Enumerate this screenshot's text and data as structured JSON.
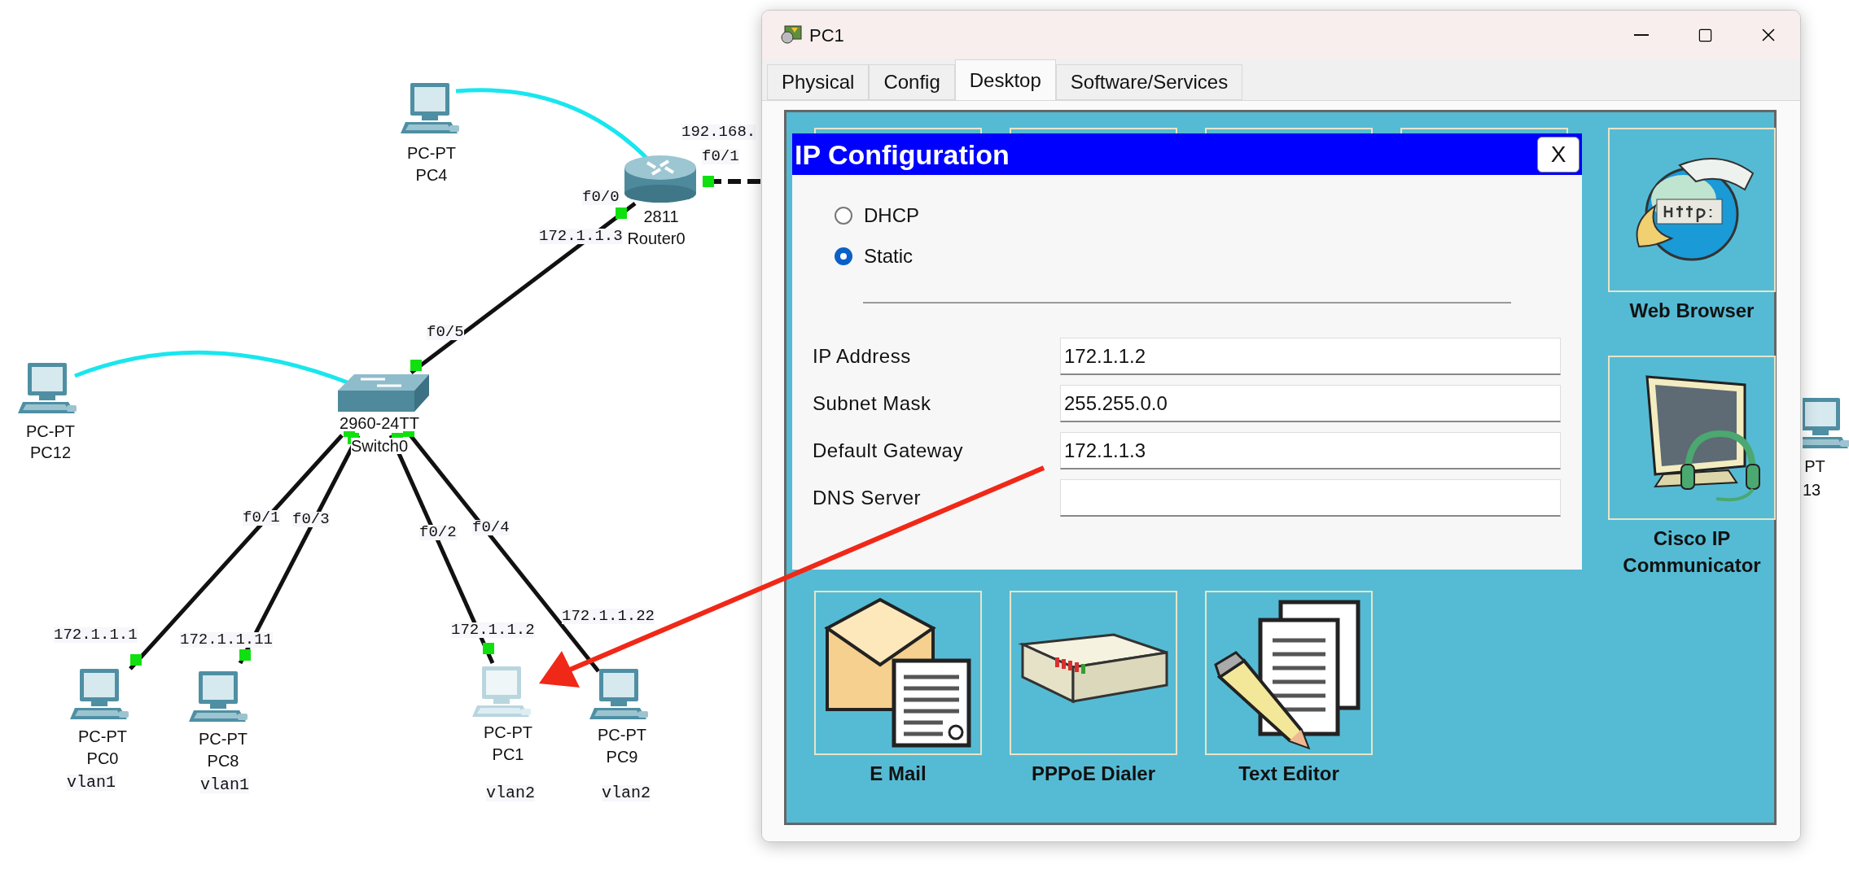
{
  "topology": {
    "devices": [
      {
        "kind": "pc",
        "model": "PC-PT",
        "name": "PC4",
        "selected": false
      },
      {
        "kind": "router",
        "model": "2811",
        "name": "Router0",
        "selected": false
      },
      {
        "kind": "pc",
        "model": "PC-PT",
        "name": "PC12",
        "selected": false
      },
      {
        "kind": "switch",
        "model": "2960-24TT",
        "name": "Switch0",
        "selected": false
      },
      {
        "kind": "pc",
        "model": "PT",
        "name": "13",
        "selected": false
      },
      {
        "kind": "pc",
        "model": "PC-PT",
        "name": "PC0",
        "note": "vlan1",
        "selected": false
      },
      {
        "kind": "pc",
        "model": "PC-PT",
        "name": "PC8",
        "note": "vlan1",
        "selected": false
      },
      {
        "kind": "pc",
        "model": "PC-PT",
        "name": "PC1",
        "note": "vlan2",
        "selected": true
      },
      {
        "kind": "pc",
        "model": "PC-PT",
        "name": "PC9",
        "note": "vlan2",
        "selected": false
      }
    ],
    "port_labels": [
      "192.168.",
      "f0/1",
      "f0/0",
      "172.1.1.3",
      "f0/5",
      "f0/1",
      "f0/3",
      "f0/2",
      "f0/4",
      "172.1.1.1",
      "172.1.1.11",
      "172.1.1.2",
      "172.1.1.22"
    ]
  },
  "window": {
    "title": "PC1",
    "tabs": [
      {
        "label": "Physical",
        "selected": false
      },
      {
        "label": "Config",
        "selected": false
      },
      {
        "label": "Desktop",
        "selected": true
      },
      {
        "label": "Software/Services",
        "selected": false
      }
    ],
    "apps": [
      {
        "kind": "browser",
        "label": "Web Browser"
      },
      {
        "kind": "phone",
        "label": "Cisco IP Communicator"
      },
      {
        "kind": "mail",
        "label": "E Mail"
      },
      {
        "kind": "dialer",
        "label": "PPPoE Dialer"
      },
      {
        "kind": "editor",
        "label": "Text Editor"
      }
    ],
    "ip_configuration": {
      "title": "IP Configuration",
      "close": "X",
      "modes": [
        {
          "label": "DHCP",
          "selected": false
        },
        {
          "label": "Static",
          "selected": true
        }
      ],
      "fields": [
        {
          "label": "IP Address",
          "value": "172.1.1.2"
        },
        {
          "label": "Subnet Mask",
          "value": "255.255.0.0"
        },
        {
          "label": "Default Gateway",
          "value": "172.1.1.3"
        },
        {
          "label": "DNS Server"
        }
      ]
    }
  }
}
